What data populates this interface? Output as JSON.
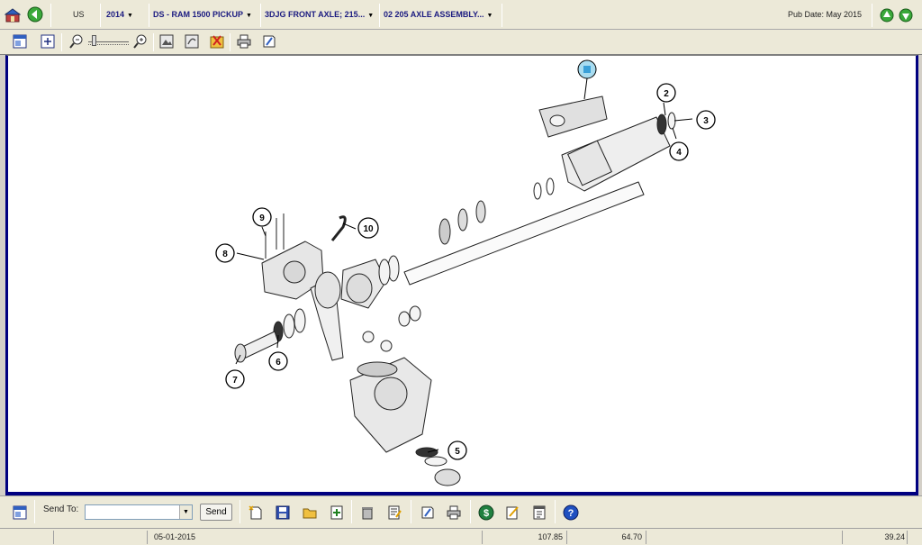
{
  "header": {
    "region": "US",
    "year": "2014",
    "model": "DS - RAM 1500 PICKUP",
    "component": "3DJG FRONT AXLE; 215...",
    "group": "02 205 AXLE ASSEMBLY...",
    "pub_date": "Pub Date: May 2015"
  },
  "bottom": {
    "send_to_label": "Send To:",
    "send_to_value": "",
    "send_button": "Send"
  },
  "status": {
    "date": "05-01-2015",
    "v1": "107.85",
    "v2": "64.70",
    "v3": "39.24"
  },
  "callouts": [
    "1",
    "2",
    "3",
    "4",
    "5",
    "6",
    "7",
    "8",
    "9",
    "10"
  ]
}
